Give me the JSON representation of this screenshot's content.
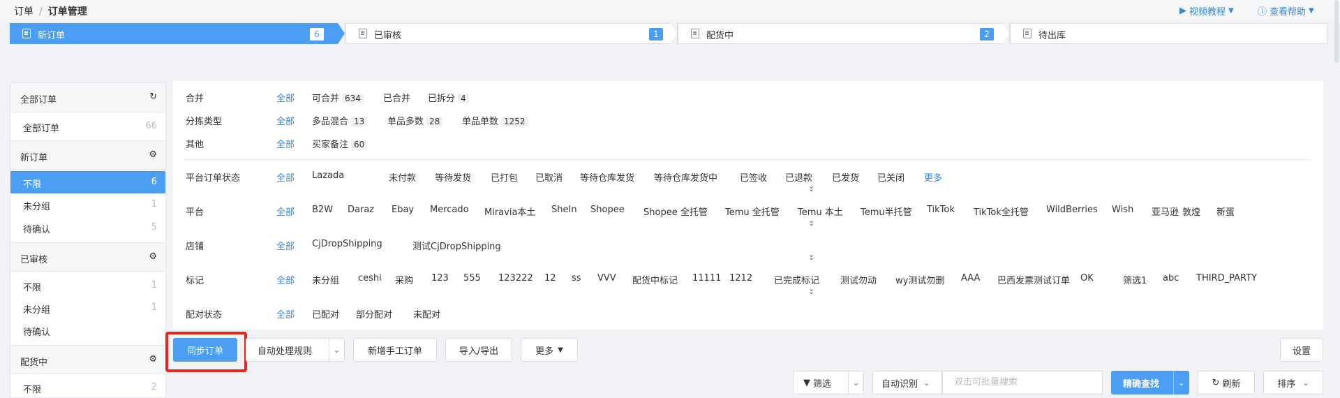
{
  "breadcrumb": {
    "root": "订单",
    "current": "订单管理"
  },
  "help": {
    "video": "视频教程",
    "help": "查看帮助"
  },
  "steps": [
    {
      "label": "新订单",
      "count": "6"
    },
    {
      "label": "已审核",
      "count": "1"
    },
    {
      "label": "配货中",
      "count": "2"
    },
    {
      "label": "待出库",
      "count": ""
    }
  ],
  "sidebar": {
    "groups": [
      {
        "title": "全部订单",
        "icon": "refresh-icon",
        "items": [
          {
            "label": "全部订单",
            "count": "66"
          }
        ]
      },
      {
        "title": "新订单",
        "icon": "gear-icon",
        "items": [
          {
            "label": "不限",
            "count": "6"
          },
          {
            "label": "未分组",
            "count": "1"
          },
          {
            "label": "待确认",
            "count": "5"
          }
        ]
      },
      {
        "title": "已审核",
        "icon": "gear-icon",
        "items": [
          {
            "label": "不限",
            "count": "1"
          },
          {
            "label": "未分组",
            "count": "1"
          },
          {
            "label": "待确认",
            "count": ""
          }
        ]
      },
      {
        "title": "配货中",
        "icon": "gear-icon",
        "items": [
          {
            "label": "不限",
            "count": "2"
          }
        ]
      }
    ]
  },
  "filters": {
    "all_label": "全部",
    "more_label": "更多",
    "rows": [
      {
        "label": "合并",
        "options": [
          {
            "t": "可合并",
            "c": "634"
          },
          {
            "t": "已合并",
            "c": ""
          },
          {
            "t": "已拆分",
            "c": "4"
          }
        ]
      },
      {
        "label": "分拣类型",
        "options": [
          {
            "t": "多品混合",
            "c": "13"
          },
          {
            "t": "单品多数",
            "c": "28"
          },
          {
            "t": "单品单数",
            "c": "1252"
          }
        ]
      },
      {
        "label": "其他",
        "options": [
          {
            "t": "买家备注",
            "c": "60"
          }
        ]
      },
      {
        "label": "平台订单状态",
        "options": [
          {
            "t": "Lazada"
          },
          {
            "t": "未付款"
          },
          {
            "t": "等待发货"
          },
          {
            "t": "已打包"
          },
          {
            "t": "已取消"
          },
          {
            "t": "等待仓库发货"
          },
          {
            "t": "等待仓库发货中"
          },
          {
            "t": "已签收"
          },
          {
            "t": "已退款"
          },
          {
            "t": "已发货"
          },
          {
            "t": "已关闭"
          }
        ]
      },
      {
        "label": "平台",
        "options": [
          {
            "t": "B2W"
          },
          {
            "t": "Daraz"
          },
          {
            "t": "Ebay"
          },
          {
            "t": "Mercado"
          },
          {
            "t": "Miravia本土"
          },
          {
            "t": "SheIn"
          },
          {
            "t": "Shopee"
          },
          {
            "t": "Shopee 全托管"
          },
          {
            "t": "Temu 全托管"
          },
          {
            "t": "Temu 本土"
          },
          {
            "t": "Temu半托管"
          },
          {
            "t": "TikTok"
          },
          {
            "t": "TikTok全托管"
          },
          {
            "t": "WildBerries"
          },
          {
            "t": "Wish"
          },
          {
            "t": "亚马逊"
          },
          {
            "t": "敦煌"
          },
          {
            "t": "新蛋"
          }
        ]
      },
      {
        "label": "店铺",
        "options": [
          {
            "t": "CjDropShipping"
          },
          {
            "t": "测试CjDropShipping"
          }
        ]
      },
      {
        "label": "标记",
        "options": [
          {
            "t": "未分组"
          },
          {
            "t": "ceshi"
          },
          {
            "t": "采购"
          },
          {
            "t": "123"
          },
          {
            "t": "555"
          },
          {
            "t": "123222"
          },
          {
            "t": "12"
          },
          {
            "t": "ss"
          },
          {
            "t": "VVV"
          },
          {
            "t": "配货中标记"
          },
          {
            "t": "11111"
          },
          {
            "t": "1212"
          },
          {
            "t": "已完成标记"
          },
          {
            "t": "测试勿动"
          },
          {
            "t": "wy测试勿删"
          },
          {
            "t": "AAA"
          },
          {
            "t": "巴西发票测试订单"
          },
          {
            "t": "OK"
          },
          {
            "t": "筛选1"
          },
          {
            "t": "abc"
          },
          {
            "t": "THIRD_PARTY"
          }
        ]
      },
      {
        "label": "配对状态",
        "options": [
          {
            "t": "已配对"
          },
          {
            "t": "部分配对"
          },
          {
            "t": "未配对"
          }
        ]
      }
    ]
  },
  "actions": {
    "sync": "同步订单",
    "auto_rules": "自动处理规则",
    "add_manual": "新增手工订单",
    "import_export": "导入/导出",
    "more": "更多",
    "settings": "设置"
  },
  "search": {
    "filter": "筛选",
    "auto_detect": "自动识别",
    "placeholder": "双击可批量搜索",
    "exact": "精确查找",
    "refresh": "刷新",
    "sort": "排序"
  },
  "colors": {
    "accent": "#4b9ef2",
    "highlight": "#e5281f"
  }
}
